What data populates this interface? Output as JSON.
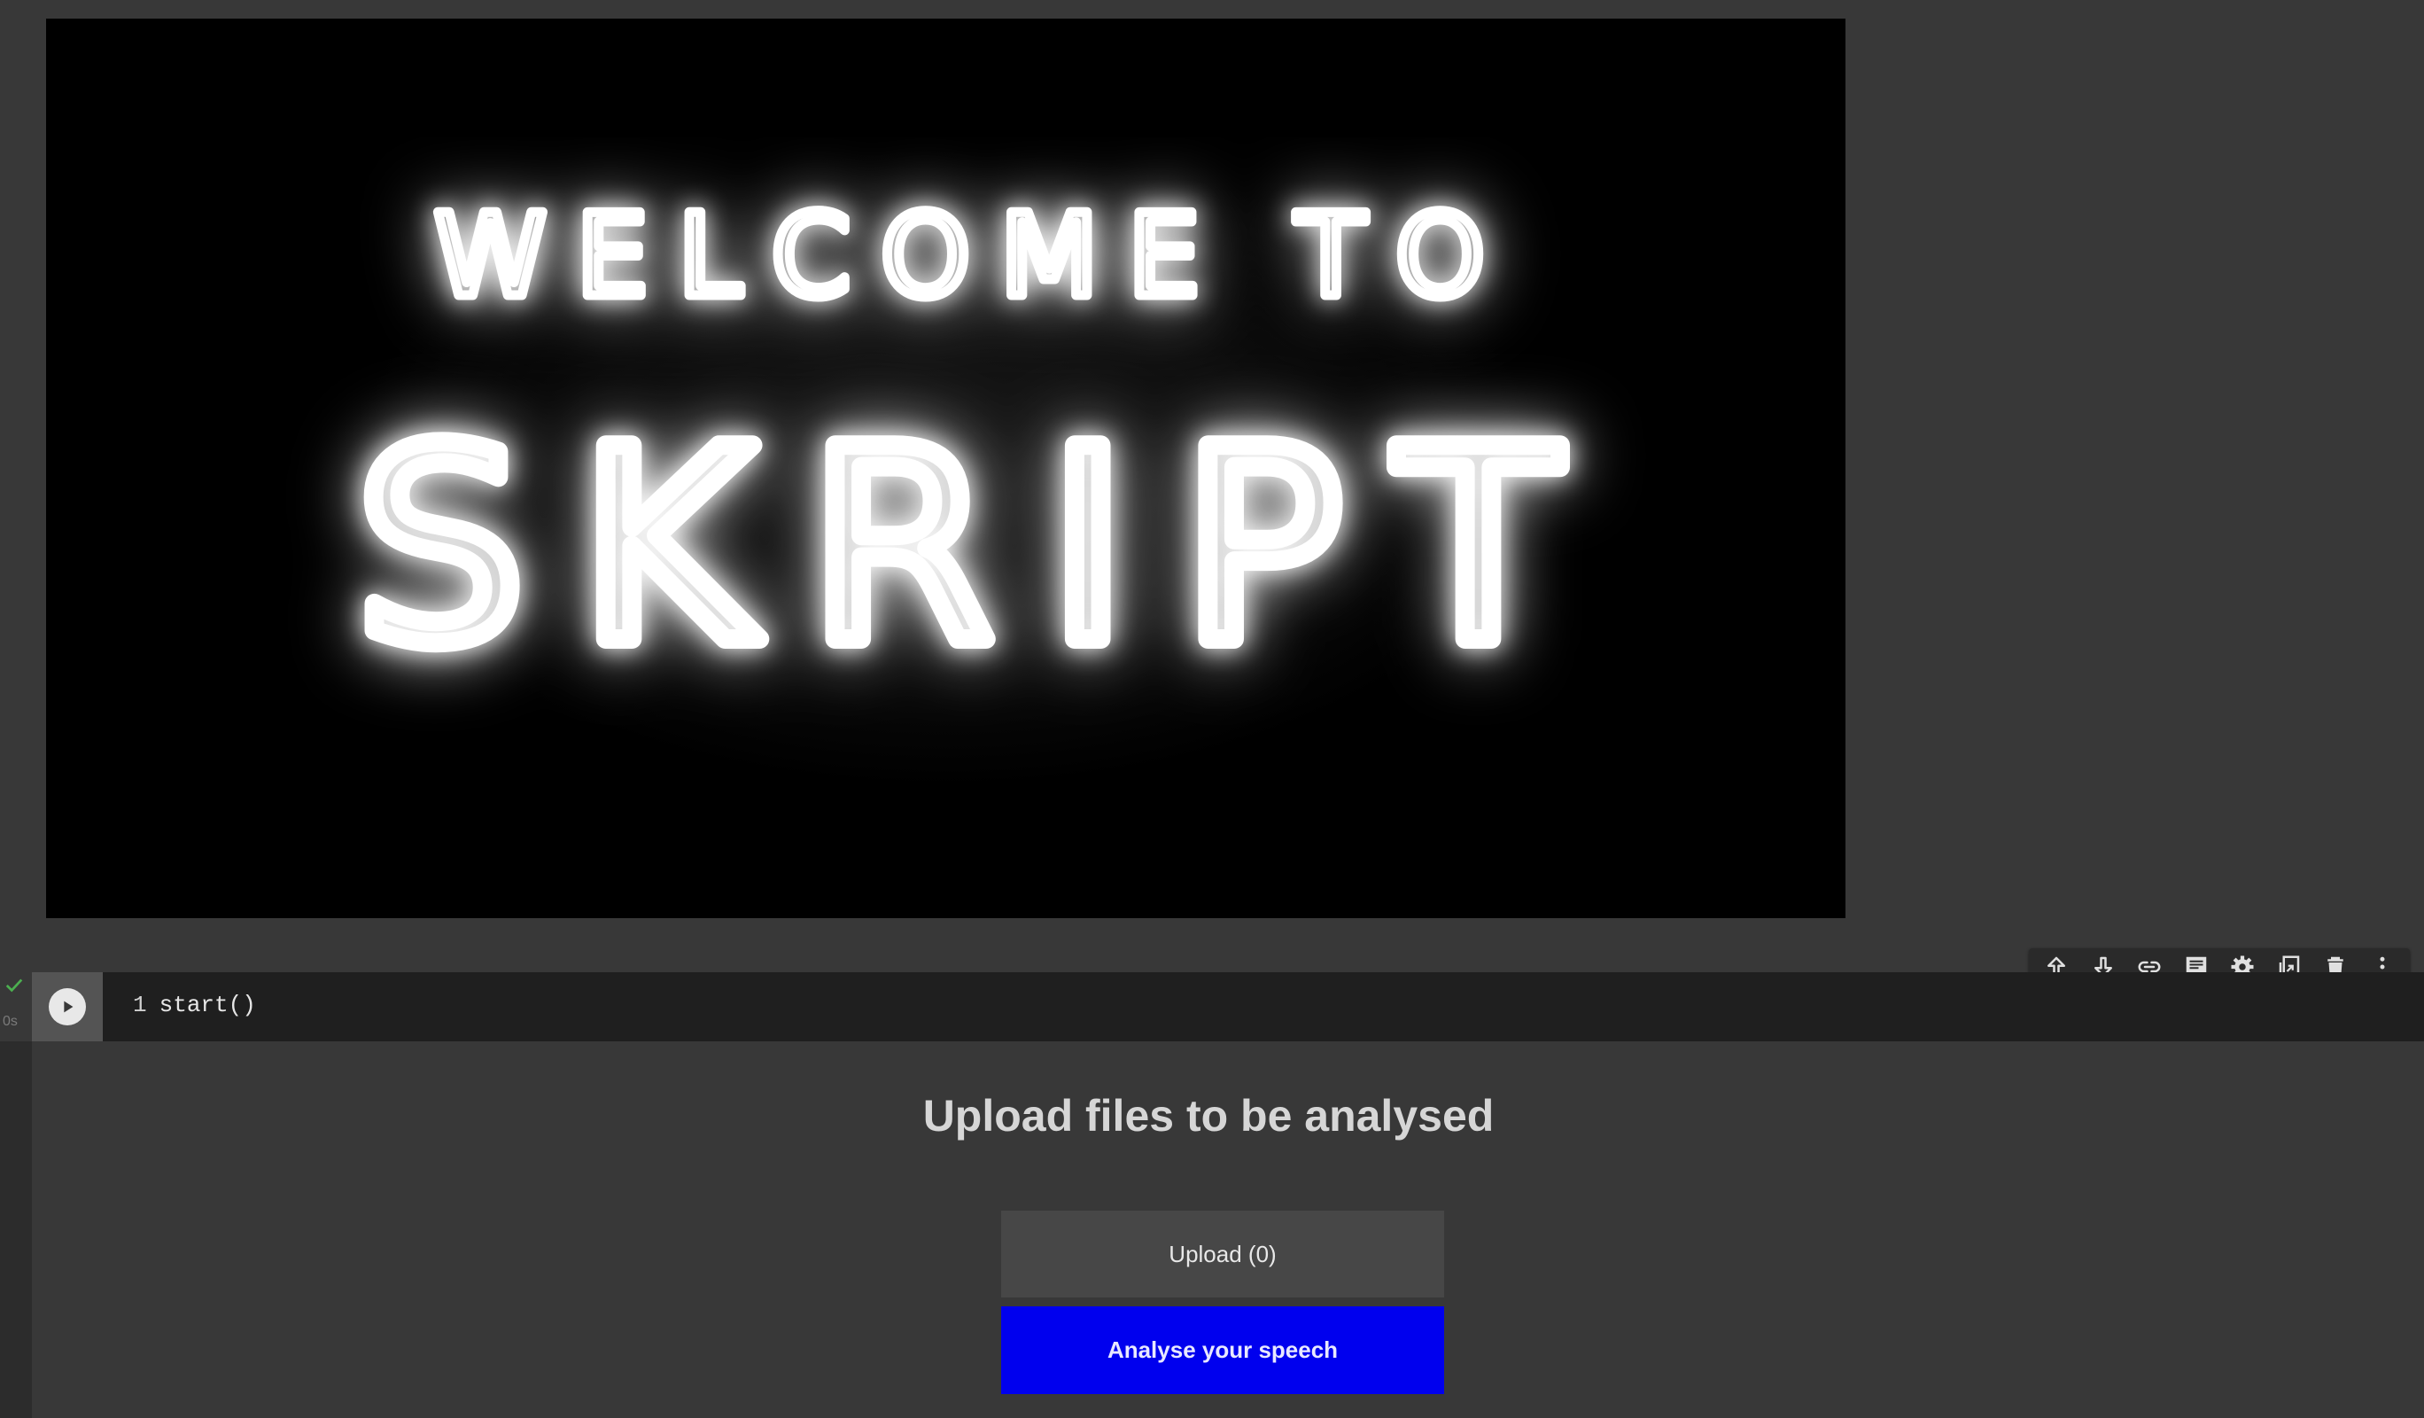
{
  "banner": {
    "line1": "WELCOME TO",
    "line2": "SKRIPT"
  },
  "cell_toolbar": {
    "icons": [
      "arrow-up-icon",
      "arrow-down-icon",
      "link-icon",
      "comment-icon",
      "gear-icon",
      "mirror-cell-icon",
      "trash-icon",
      "more-vert-icon"
    ]
  },
  "code_cell": {
    "status_time": "0s",
    "line_number": "1",
    "code": "start()"
  },
  "output": {
    "title": "Upload files to be analysed",
    "upload_label": "Upload (0)",
    "analyse_label": "Analyse your speech",
    "analyse_color": "#0000ee"
  }
}
